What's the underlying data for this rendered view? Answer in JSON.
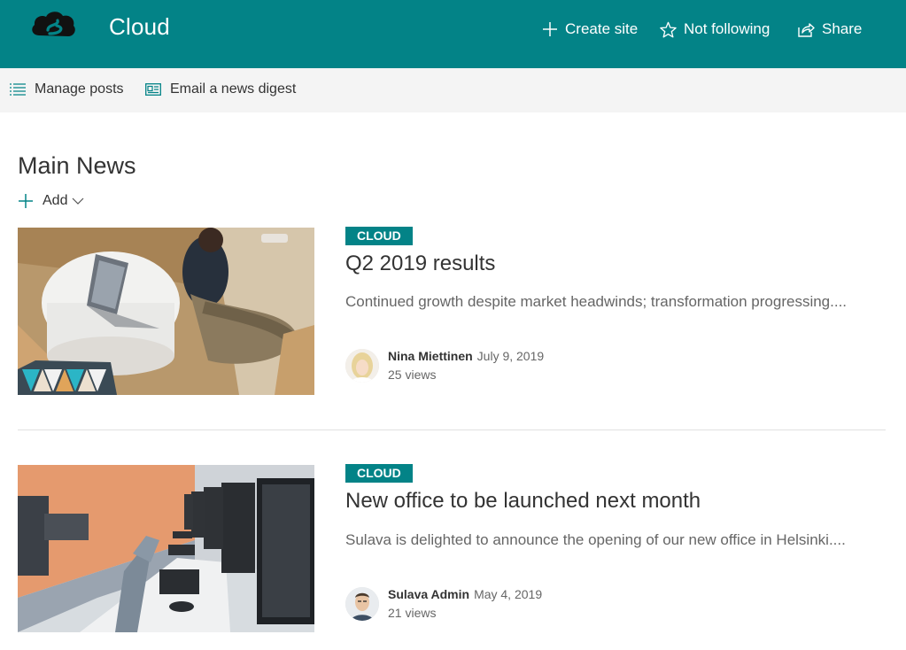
{
  "header": {
    "site_title": "Cloud",
    "actions": {
      "create": "Create site",
      "follow": "Not following",
      "share": "Share"
    }
  },
  "command_bar": {
    "manage_posts": "Manage posts",
    "email_digest": "Email a news digest"
  },
  "section": {
    "title": "Main News",
    "add_label": "Add"
  },
  "news": [
    {
      "category": "CLOUD",
      "title": "Q2 2019 results",
      "description": "Continued growth despite market headwinds; transformation progressing....",
      "author": "Nina Miettinen",
      "date": "July 9, 2019",
      "views": "25 views"
    },
    {
      "category": "CLOUD",
      "title": "New office to be launched next month",
      "description": "Sulava is delighted to announce the opening of our new office in Helsinki....",
      "author": "Sulava Admin",
      "date": "May 4, 2019",
      "views": "21 views"
    }
  ],
  "colors": {
    "header_bg": "#038387",
    "command_bar_bg": "#f4f4f4",
    "badge_bg": "#038387"
  }
}
